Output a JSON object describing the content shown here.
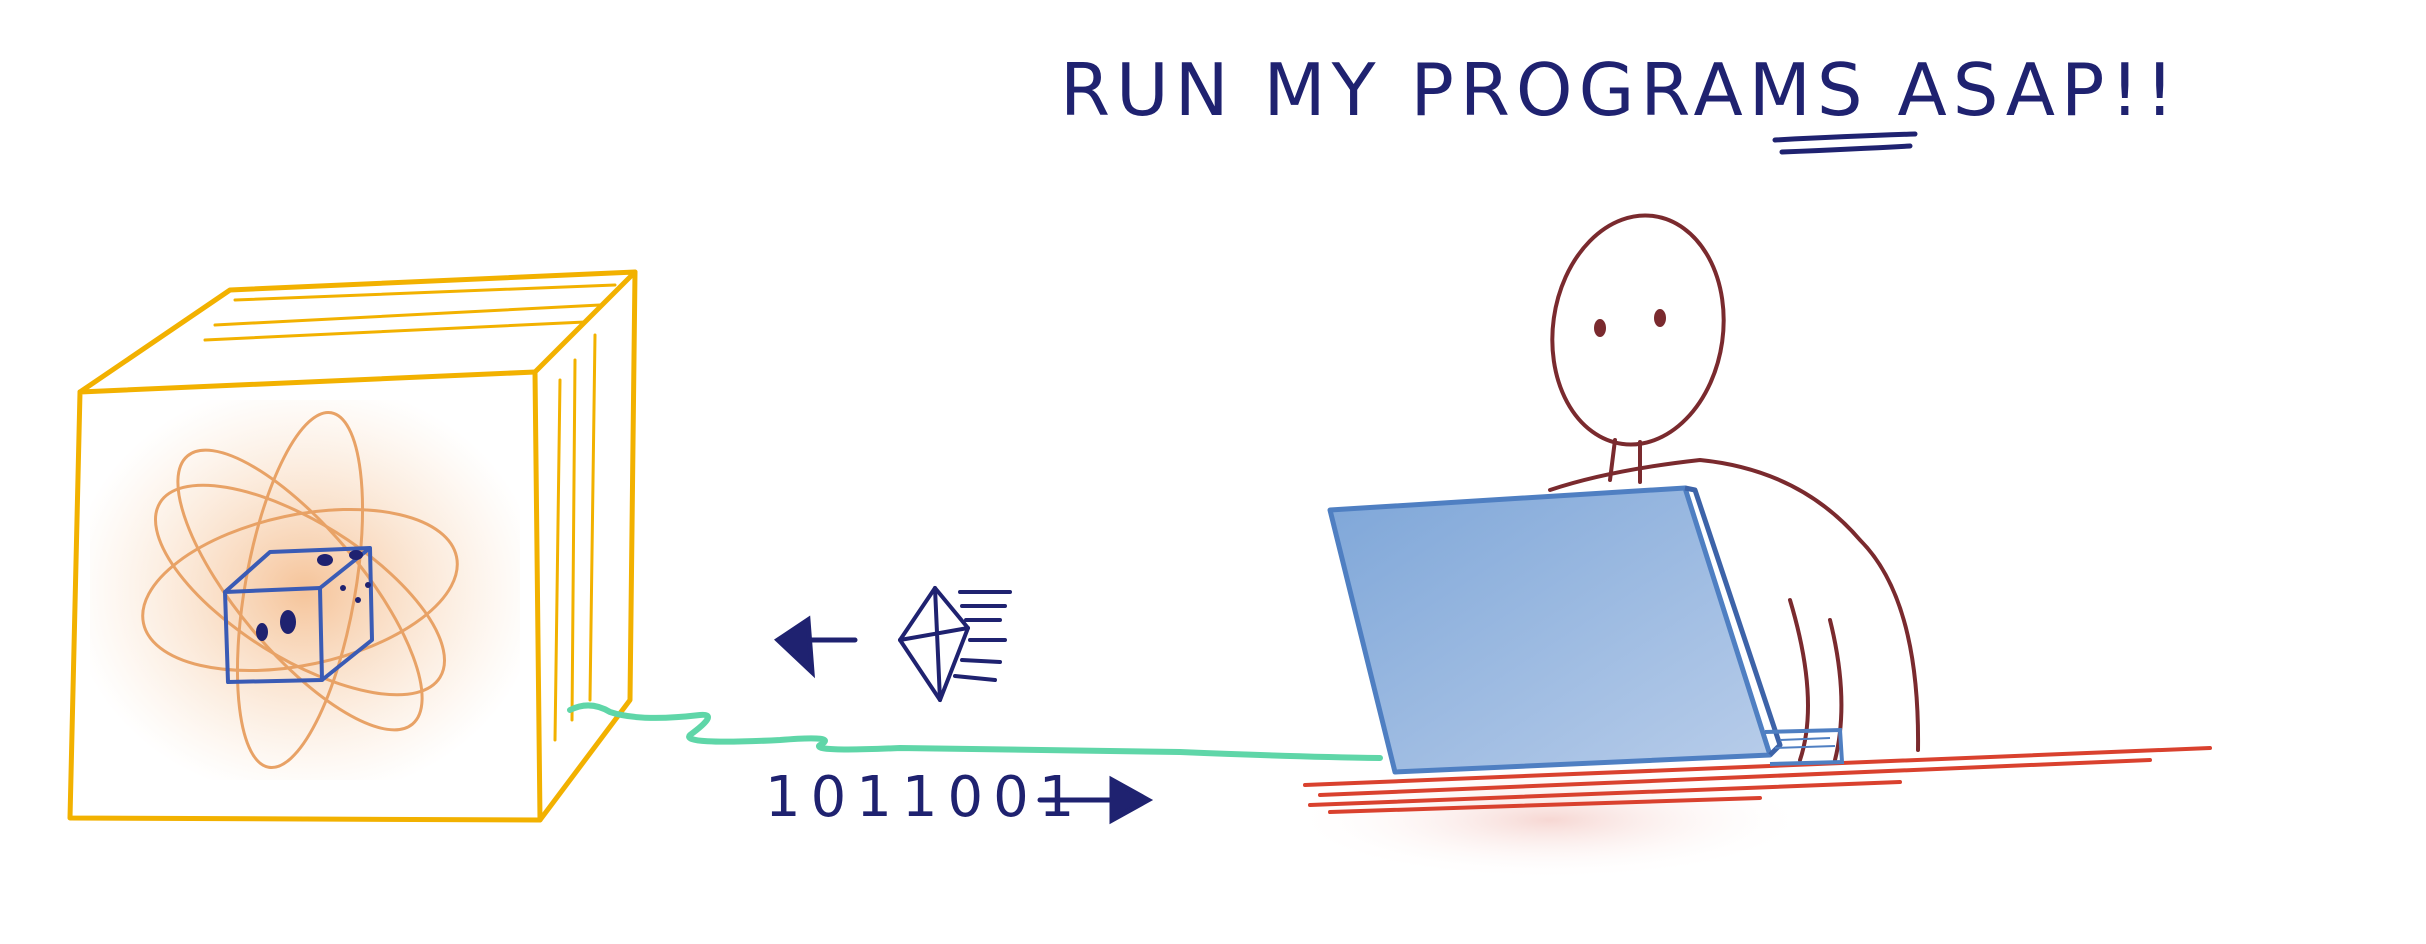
{
  "title": {
    "main": "RUN MY PROGRAMS ",
    "emphasis": "ASAP",
    "trailing": "!!"
  },
  "bitstring": "1011001",
  "colors": {
    "ink": "#1f2270",
    "computer": "#f2b100",
    "computer_glow": "#f6c79a",
    "cable": "#5fd6a8",
    "person": "#7a2a2e",
    "laptop": "#5f8fcf",
    "desk": "#d9412e"
  }
}
